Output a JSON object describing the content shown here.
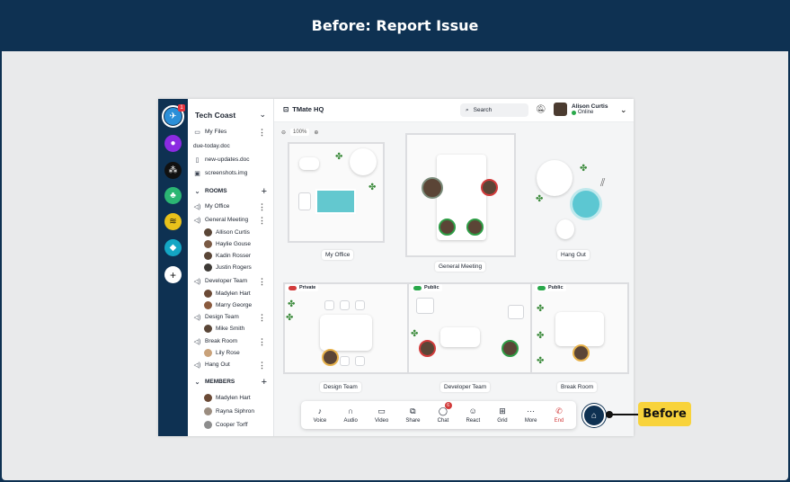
{
  "banner": {
    "title": "Before: Report Issue"
  },
  "workspace": {
    "name": "Tech Coast"
  },
  "files": {
    "header": "My Files",
    "items": [
      "due-today.doc",
      "new-updates.doc",
      "screenshots.img"
    ]
  },
  "rooms": {
    "header": "ROOMS",
    "items": [
      {
        "name": "My Office",
        "members": []
      },
      {
        "name": "General Meeting",
        "members": [
          "Allison Curtis",
          "Haylie Gouse",
          "Kadin Rosser",
          "Justin Rogers"
        ]
      },
      {
        "name": "Developer Team",
        "members": [
          "Madylen Hart",
          "Marry George"
        ]
      },
      {
        "name": "Design Team",
        "members": [
          "Mike Smith"
        ]
      },
      {
        "name": "Break Room",
        "members": [
          "Lily Rose"
        ]
      },
      {
        "name": "Hang Out",
        "members": []
      }
    ]
  },
  "members": {
    "header": "MEMBERS",
    "items": [
      "Madylen Hart",
      "Rayna Siphron",
      "Cooper Torff"
    ]
  },
  "topbar": {
    "app_title": "TMate HQ",
    "search_placeholder": "Search",
    "user_name": "Alison Curtis",
    "user_status": "Online"
  },
  "zoom": {
    "level": "100%"
  },
  "map": {
    "rooms": {
      "my_office": "My Office",
      "general_meeting": "General Meeting",
      "hang_out": "Hang Out",
      "design_team": "Design Team",
      "developer_team": "Developer Team",
      "break_room": "Break Room"
    },
    "tags": {
      "private": "Private",
      "public1": "Public",
      "public2": "Public"
    }
  },
  "toolbar": {
    "items": [
      {
        "label": "Voice",
        "icon": "mic-icon"
      },
      {
        "label": "Audio",
        "icon": "headphones-icon"
      },
      {
        "label": "Video",
        "icon": "video-icon"
      },
      {
        "label": "Share",
        "icon": "share-screen-icon"
      },
      {
        "label": "Chat",
        "icon": "chat-icon",
        "count": "6"
      },
      {
        "label": "React",
        "icon": "smile-icon"
      },
      {
        "label": "Grid",
        "icon": "grid-icon"
      },
      {
        "label": "More",
        "icon": "more-icon"
      },
      {
        "label": "End",
        "icon": "end-call-icon"
      }
    ]
  },
  "callout": {
    "label": "Before"
  },
  "colors": {
    "navy": "#0e3152",
    "callout": "#f8d33b",
    "online": "#29a84a",
    "danger": "#d23b3b"
  }
}
